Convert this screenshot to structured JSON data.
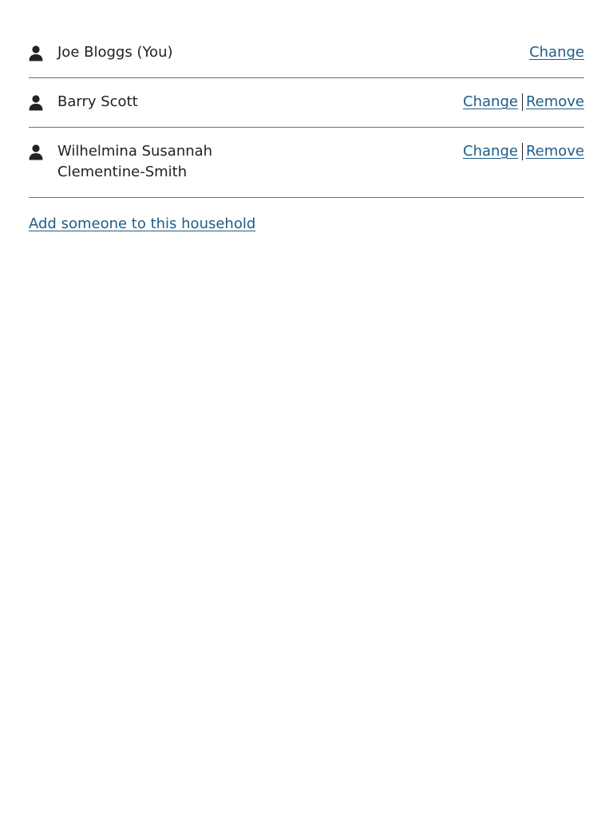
{
  "household": {
    "members": [
      {
        "name": "Joe Bloggs (You)",
        "change_label": "Change",
        "remove_label": null
      },
      {
        "name": "Barry Scott",
        "change_label": "Change",
        "remove_label": "Remove"
      },
      {
        "name": "Wilhelmina Susannah Clementine-Smith",
        "change_label": "Change",
        "remove_label": "Remove"
      }
    ],
    "add_label": "Add someone to this household"
  },
  "icons": {
    "member": "person-icon"
  },
  "colors": {
    "link": "#1f5c85",
    "text": "#222222",
    "divider": "#707070"
  }
}
